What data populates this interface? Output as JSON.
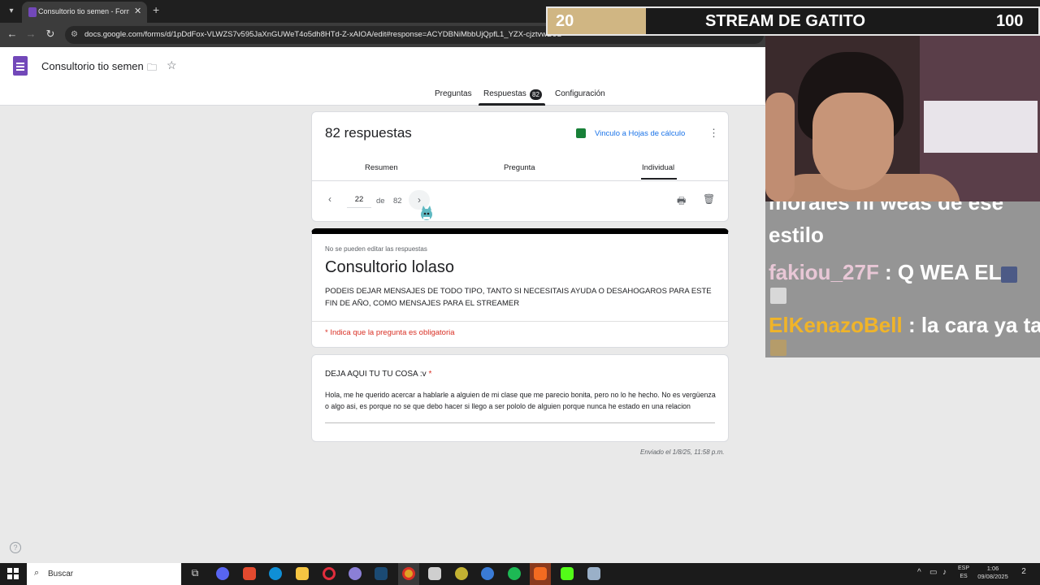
{
  "browser": {
    "tab_title": "Consultorio tio semen - Formul",
    "url": "docs.google.com/forms/d/1pDdFox-VLWZS7v595JaXnGUWeT4o5dh8HTd-Z-xAIOA/edit#response=ACYDBNiMbbUjQpfL1_YZX-cjztvwD9S"
  },
  "forms": {
    "title": "Consultorio tio semen",
    "tabs": [
      "Preguntas",
      "Respuestas",
      "Configuración"
    ],
    "responses_badge": "82"
  },
  "summary_card": {
    "heading": "82 respuestas",
    "sheets_link": "Vinculo a Hojas de cálculo",
    "subtabs": [
      "Resumen",
      "Pregunta",
      "Individual"
    ],
    "current": "22",
    "of_label": "de",
    "total": "82"
  },
  "form_card": {
    "notice": "No se pueden editar las respuestas",
    "title": "Consultorio lolaso",
    "description": "PODEIS DEJAR MENSAJES DE TODO TIPO, TANTO SI NECESITAIS AYUDA O DESAHOGAROS PARA ESTE FIN DE AÑO, COMO MENSAJES PARA EL STREAMER",
    "required_note": "* Indica que la pregunta es obligatoria"
  },
  "question_card": {
    "label": "DEJA AQUI TU TU COSA :v",
    "required_mark": "*",
    "answer": "Hola, me he querido acercar a hablarle a alguien de mi clase que me parecio bonita, pero no lo he hecho. No es vergüenza o algo asi, es porque no se que debo hacer si llego a ser pololo de alguien porque nunca he estado en una relacion"
  },
  "submitted_at": "Enviado el 1/8/25, 11:58 p.m.",
  "stream": {
    "sub_count": "20",
    "sub_title": "STREAM DE GATITO",
    "sub_goal": "100",
    "sub_progress": 0.2,
    "chat_cut_text": "morales ni weas de ese",
    "chat": [
      {
        "text": "estilo",
        "user": "",
        "user_color": "#ffffff"
      },
      {
        "user": "fakiou_27F",
        "text": " : Q WEA EL",
        "user_color": "#e8c7d6"
      },
      {
        "user": "ElKenazoBell",
        "text": " : la cara ya ta",
        "user_color": "#f0b429"
      }
    ]
  },
  "taskbar": {
    "search_placeholder": "Buscar",
    "lang_top": "ESP",
    "lang_bottom": "ES",
    "time": "1:06",
    "date": "09/08/2025",
    "notifications": "2"
  }
}
